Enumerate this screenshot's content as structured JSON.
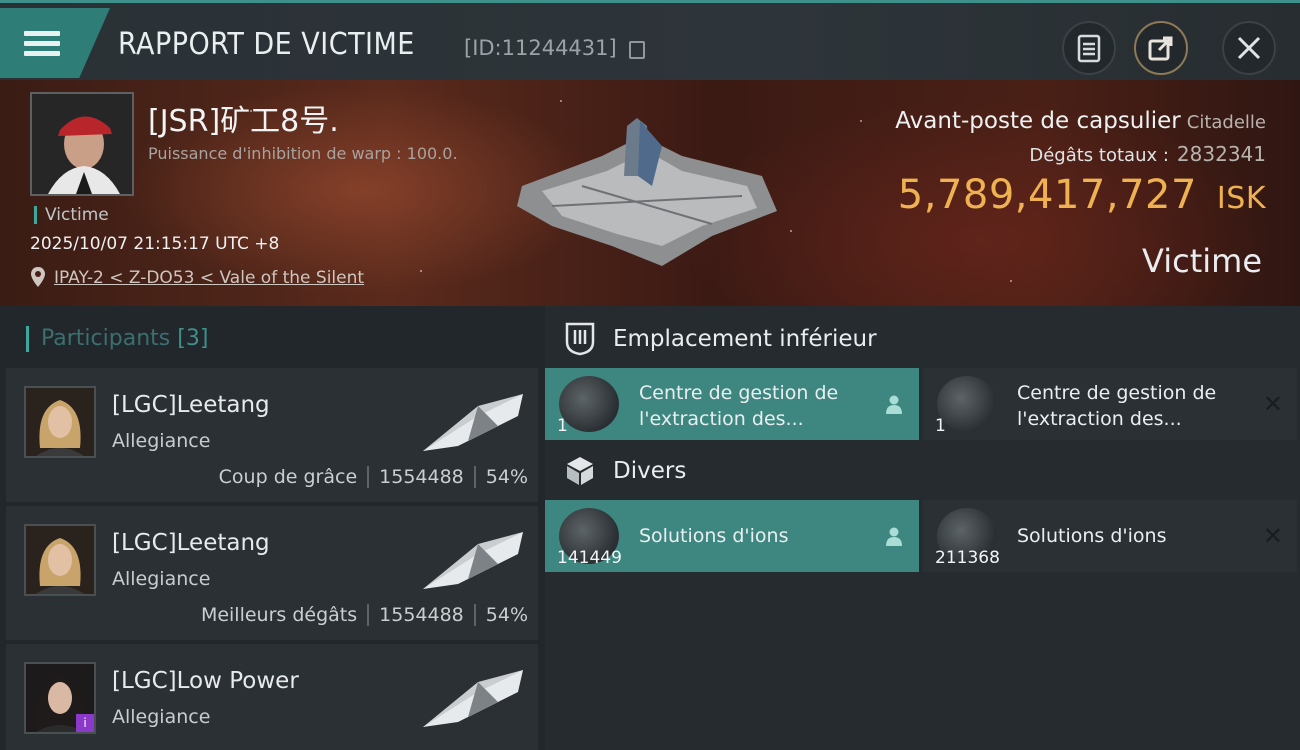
{
  "header": {
    "title": "RAPPORT DE VICTIME",
    "id_text": "[ID:11244431]"
  },
  "victim": {
    "name": "[JSR]矿工8号.",
    "warp_text": "Puissance d'inhibition de warp : 100.0.",
    "role_tag": "Victime",
    "datetime": "2025/10/07 21:15:17 UTC +8",
    "location": "IPAY-2 < Z-DO53 < Vale of the Silent",
    "ship_type": "Avant-poste de capsulier",
    "ship_class": "Citadelle",
    "damage_label": "Dégâts totaux :",
    "damage_value": "2832341",
    "isk_value": "5,789,417,727",
    "isk_unit": "ISK",
    "status": "Victime"
  },
  "participants": {
    "title": "Participants",
    "count": "[3]",
    "items": [
      {
        "name": "[LGC]Leetang",
        "corp": "Allegiance",
        "role": "Coup de grâce",
        "damage": "1554488",
        "percent": "54%"
      },
      {
        "name": "[LGC]Leetang",
        "corp": "Allegiance",
        "role": "Meilleurs dégâts",
        "damage": "1554488",
        "percent": "54%"
      },
      {
        "name": "[LGC]Low Power",
        "corp": "Allegiance"
      }
    ]
  },
  "fitting": {
    "low_slot_title": "Emplacement inférieur",
    "misc_title": "Divers",
    "low_slots": [
      {
        "label": "Centre de gestion de l'extraction des...",
        "qty": "1",
        "state": "dropped"
      },
      {
        "label": "Centre de gestion de l'extraction des...",
        "qty": "1",
        "state": "destroyed"
      }
    ],
    "misc": [
      {
        "label": "Solutions d'ions",
        "qty": "141449",
        "state": "dropped"
      },
      {
        "label": "Solutions d'ions",
        "qty": "211368",
        "state": "destroyed"
      }
    ]
  },
  "colors": {
    "accent": "#3e8780",
    "isk": "#f0b250",
    "hero": "#5a2a1c"
  }
}
